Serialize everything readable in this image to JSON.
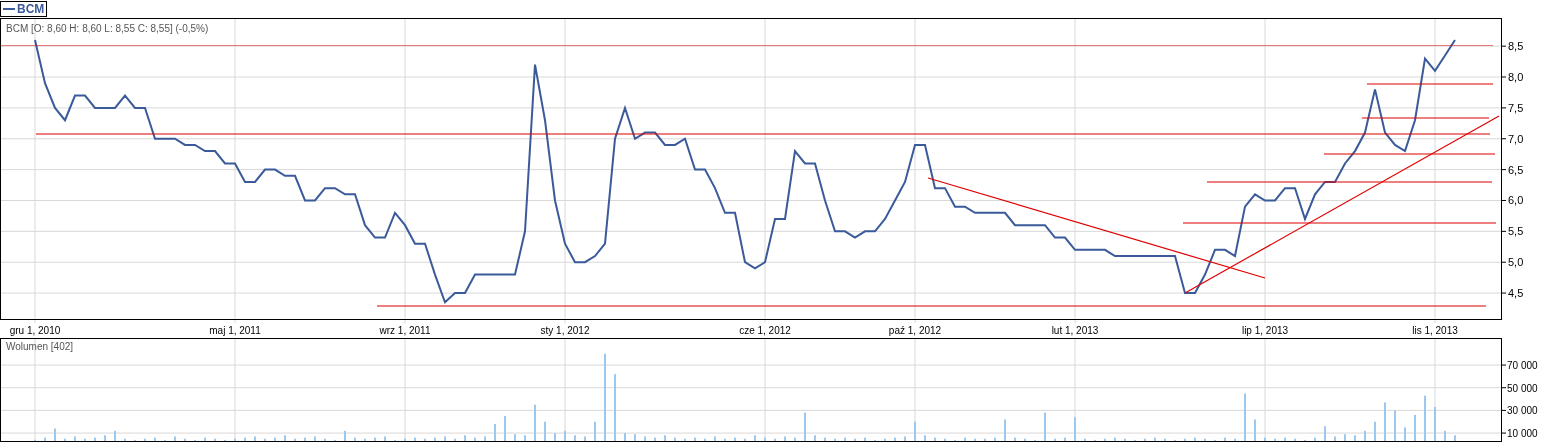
{
  "price_panel": {
    "chart_data": {
      "type": "line",
      "title": "BCM [O: 8,60  H: 8,60  L: 8,55  C: 8,55] (-0,5%)",
      "categories": [
        "gru 1, 2010",
        null,
        null,
        null,
        null,
        null,
        null,
        null,
        null,
        null,
        null,
        null,
        null,
        null,
        null,
        null,
        null,
        null,
        null,
        null,
        "maj 1, 2011",
        null,
        null,
        null,
        null,
        null,
        null,
        null,
        null,
        null,
        null,
        null,
        null,
        null,
        null,
        null,
        null,
        "wrz 1, 2011",
        null,
        null,
        null,
        null,
        null,
        null,
        null,
        null,
        null,
        null,
        null,
        null,
        null,
        null,
        null,
        "sty 1, 2012",
        null,
        null,
        null,
        null,
        null,
        null,
        null,
        null,
        null,
        null,
        null,
        null,
        null,
        null,
        null,
        null,
        null,
        null,
        null,
        "cze 1, 2012",
        null,
        null,
        null,
        null,
        null,
        null,
        null,
        null,
        null,
        null,
        null,
        null,
        null,
        null,
        "paź 1, 2012",
        null,
        null,
        null,
        null,
        null,
        null,
        null,
        null,
        null,
        null,
        null,
        null,
        null,
        null,
        null,
        "lut 1, 2013",
        null,
        null,
        null,
        null,
        null,
        null,
        null,
        null,
        null,
        null,
        null,
        null,
        null,
        null,
        null,
        null,
        null,
        null,
        "lip 1, 2013",
        null,
        null,
        null,
        null,
        null,
        null,
        null,
        null,
        null,
        null,
        null,
        null,
        null,
        null,
        null,
        null,
        "lis 1, 2013",
        null,
        null
      ],
      "grid": true,
      "series": [
        {
          "name": "BCM",
          "color": "#3a5a9a",
          "values": [
            8.6,
            7.9,
            7.5,
            7.3,
            7.7,
            7.7,
            7.5,
            7.5,
            7.5,
            7.7,
            7.5,
            7.5,
            7.0,
            7.0,
            7.0,
            6.9,
            6.9,
            6.8,
            6.8,
            6.6,
            6.6,
            6.3,
            6.3,
            6.5,
            6.5,
            6.4,
            6.4,
            6.0,
            6.0,
            6.2,
            6.2,
            6.1,
            6.1,
            5.6,
            5.4,
            5.4,
            5.8,
            5.6,
            5.3,
            5.3,
            4.8,
            4.35,
            4.5,
            4.5,
            4.8,
            4.8,
            4.8,
            4.8,
            4.8,
            5.5,
            8.2,
            7.3,
            6.0,
            5.3,
            5.0,
            5.0,
            5.1,
            5.3,
            7.0,
            7.5,
            7.0,
            7.1,
            7.1,
            6.9,
            6.9,
            7.0,
            6.5,
            6.5,
            6.2,
            5.8,
            5.8,
            5.0,
            4.9,
            5.0,
            5.7,
            5.7,
            6.8,
            6.6,
            6.6,
            6.0,
            5.5,
            5.5,
            5.4,
            5.5,
            5.5,
            5.7,
            6.0,
            6.3,
            6.9,
            6.9,
            6.2,
            6.2,
            5.9,
            5.9,
            5.8,
            5.8,
            5.8,
            5.8,
            5.6,
            5.6,
            5.6,
            5.6,
            5.4,
            5.4,
            5.2,
            5.2,
            5.2,
            5.2,
            5.1,
            5.1,
            5.1,
            5.1,
            5.1,
            5.1,
            5.1,
            4.5,
            4.5,
            4.8,
            5.2,
            5.2,
            5.1,
            5.9,
            6.1,
            6.0,
            6.0,
            6.2,
            6.2,
            5.7,
            6.1,
            6.3,
            6.3,
            6.6,
            6.8,
            7.1,
            7.8,
            7.1,
            6.9,
            6.8,
            7.3,
            8.3,
            8.1,
            8.35,
            8.6
          ]
        }
      ],
      "ylim": [
        4.08,
        8.94
      ],
      "yticks": [
        {
          "value": 4.5,
          "label": "4,5"
        },
        {
          "value": 5,
          "label": "5,0"
        },
        {
          "value": 5.5,
          "label": "5,5"
        },
        {
          "value": 6,
          "label": "6,0"
        },
        {
          "value": 6.5,
          "label": "6,5"
        },
        {
          "value": 7,
          "label": "7,0"
        },
        {
          "value": 7.5,
          "label": "7,5"
        },
        {
          "value": 8,
          "label": "8,0"
        },
        {
          "value": 8.5,
          "label": "8,5"
        }
      ]
    }
  },
  "volume_panel": {
    "chart_data": {
      "type": "bar",
      "title": "Wolumen [402]",
      "grid": true,
      "series": [
        {
          "color": "#9cc8f0",
          "values": [
            4000,
            6000,
            14000,
            5000,
            7000,
            5000,
            6000,
            8000,
            12000,
            5000,
            4000,
            5000,
            6000,
            4000,
            7000,
            5000,
            4000,
            6000,
            5000,
            4000,
            5000,
            6000,
            7000,
            5000,
            6000,
            8000,
            5000,
            6000,
            7000,
            5000,
            4000,
            12000,
            6000,
            5000,
            6000,
            7000,
            4000,
            5000,
            6000,
            5000,
            6000,
            7000,
            5000,
            8000,
            6000,
            7000,
            18000,
            25000,
            9000,
            8000,
            35000,
            20000,
            10000,
            12000,
            8000,
            7000,
            20000,
            80000,
            62000,
            10000,
            9000,
            7000,
            6000,
            8000,
            6000,
            5000,
            6000,
            5000,
            7000,
            5000,
            6000,
            5000,
            8000,
            6000,
            5000,
            7000,
            6000,
            28000,
            8000,
            6000,
            5000,
            6000,
            5000,
            6000,
            4000,
            5000,
            6000,
            7000,
            20000,
            8000,
            6000,
            5000,
            4000,
            6000,
            5000,
            5000,
            6000,
            22000,
            6000,
            5000,
            4000,
            28000,
            5000,
            6000,
            24000,
            5000,
            4000,
            5000,
            6000,
            5000,
            4000,
            5000,
            6000,
            5000,
            4000,
            5000,
            6000,
            5000,
            4000,
            6000,
            5000,
            45000,
            22000,
            6000,
            5000,
            6000,
            5000,
            4000,
            6000,
            16000,
            7000,
            9000,
            8000,
            12000,
            20000,
            37000,
            30000,
            15000,
            26000,
            43000,
            33000,
            12000,
            8000
          ]
        }
      ],
      "ylim": [
        3000,
        93000
      ],
      "yticks": [
        {
          "value": 10000,
          "label": "10 000"
        },
        {
          "value": 30000,
          "label": "30 000"
        },
        {
          "value": 50000,
          "label": "50 000"
        },
        {
          "value": 70000,
          "label": "70 000"
        }
      ]
    }
  }
}
